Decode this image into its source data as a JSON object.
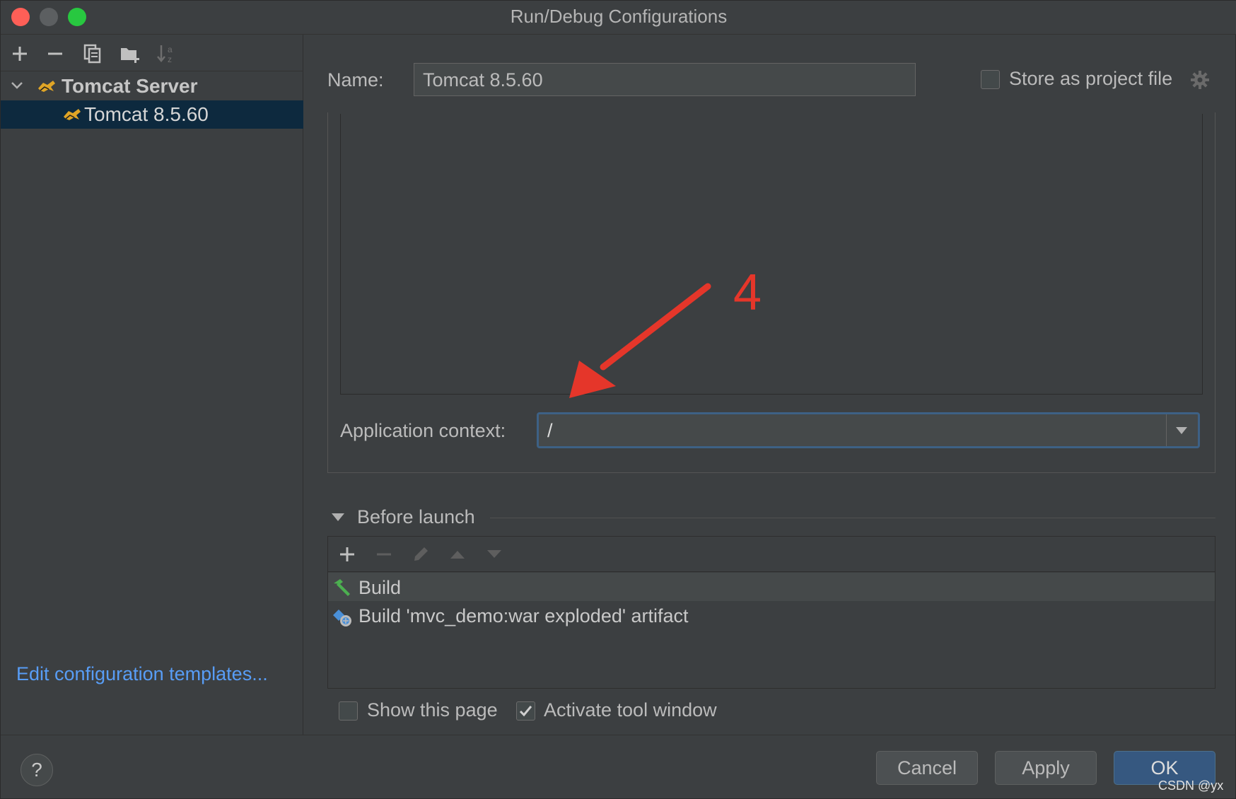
{
  "window": {
    "title": "Run/Debug Configurations"
  },
  "left_toolbar": {
    "icons": [
      "plus-icon",
      "minus-icon",
      "copy-icon",
      "new-folder-icon",
      "sort-az-icon"
    ]
  },
  "tree": {
    "group_label": "Tomcat Server",
    "child_label": "Tomcat 8.5.60"
  },
  "left_footer": {
    "edit_templates_link": "Edit configuration templates..."
  },
  "form": {
    "name_label": "Name:",
    "name_value": "Tomcat 8.5.60",
    "store_as_project_file_label": "Store as project file",
    "store_as_project_file_checked": false,
    "app_context_label": "Application context:",
    "app_context_value": "/"
  },
  "annotation": {
    "number": "4",
    "color": "#e5362a"
  },
  "before_launch": {
    "title": "Before launch",
    "items": [
      {
        "label": "Build",
        "icon": "hammer-icon"
      },
      {
        "label": "Build 'mvc_demo:war exploded' artifact",
        "icon": "artifact-icon"
      }
    ]
  },
  "options": {
    "show_this_page_label": "Show this page",
    "show_this_page_checked": false,
    "activate_tool_window_label": "Activate tool window",
    "activate_tool_window_checked": true
  },
  "buttons": {
    "help": "?",
    "cancel": "Cancel",
    "apply": "Apply",
    "ok": "OK"
  },
  "watermark": "CSDN @yx"
}
